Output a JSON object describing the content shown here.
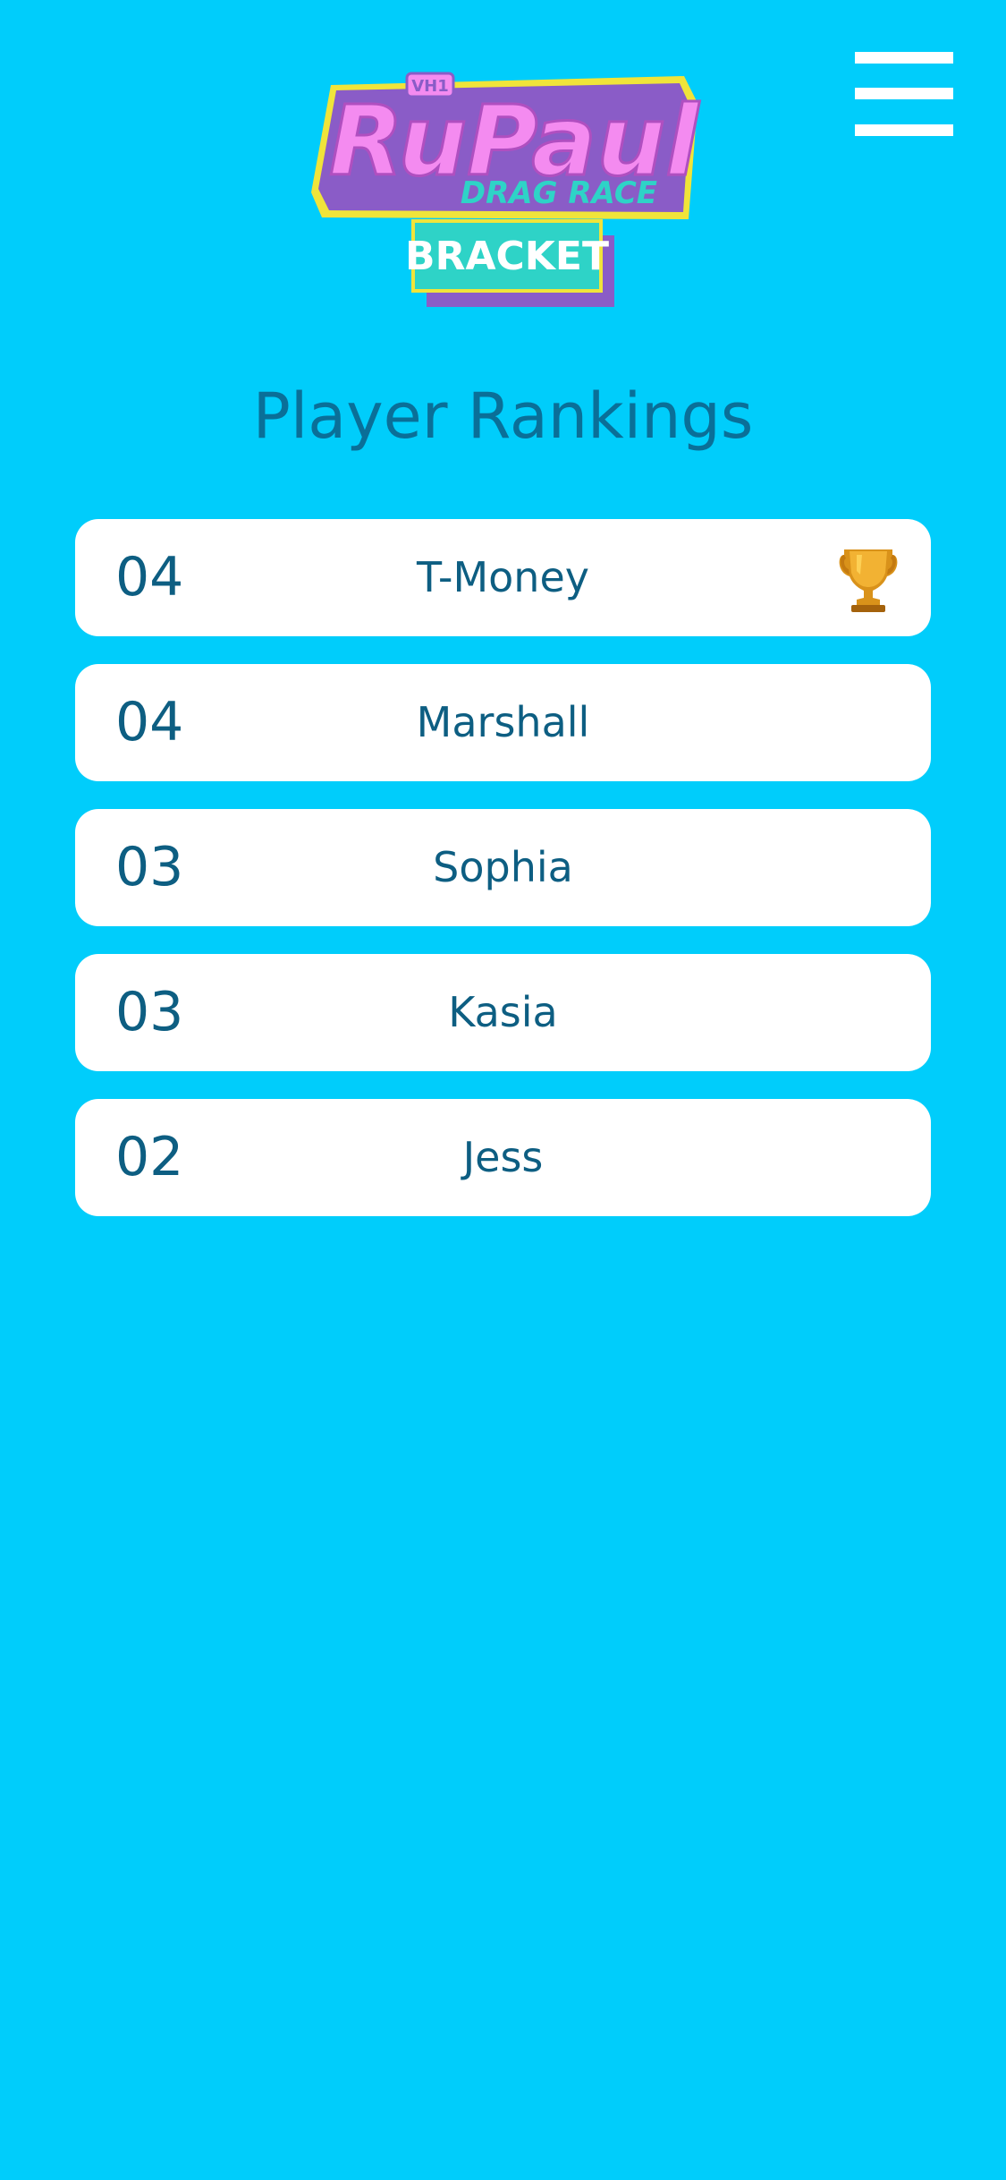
{
  "header": {
    "logo": {
      "brand_line1": "RuPaul's",
      "brand_line2": "DRAG RACE",
      "network": "VH1",
      "product": "BRACKET"
    },
    "menu_icon": "hamburger-menu-icon"
  },
  "main": {
    "title": "Player Rankings",
    "rankings": [
      {
        "score": "04",
        "name": "T-Money",
        "icon": "trophy-icon"
      },
      {
        "score": "04",
        "name": "Marshall"
      },
      {
        "score": "03",
        "name": "Sophia"
      },
      {
        "score": "03",
        "name": "Kasia"
      },
      {
        "score": "02",
        "name": "Jess"
      }
    ]
  },
  "colors": {
    "background": "#00cdfb",
    "text": "#0d5e82",
    "card": "#ffffff",
    "logo_pink": "#f48bf0",
    "logo_purple": "#8a5cc7",
    "logo_teal": "#2ed3c7"
  }
}
